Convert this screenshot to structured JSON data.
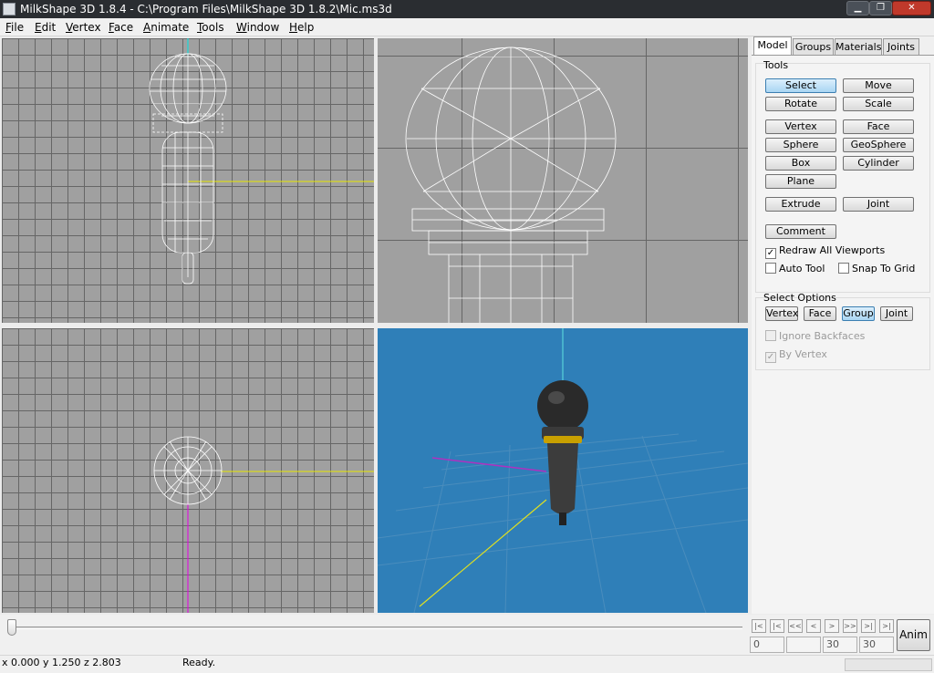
{
  "window": {
    "title": "MilkShape 3D 1.8.4 - C:\\Program Files\\MilkShape 3D 1.8.2\\Mic.ms3d"
  },
  "menu": {
    "file": "File",
    "edit": "Edit",
    "vertex": "Vertex",
    "face": "Face",
    "animate": "Animate",
    "tools": "Tools",
    "window": "Window",
    "help": "Help"
  },
  "tabs": {
    "model": "Model",
    "groups": "Groups",
    "materials": "Materials",
    "joints": "Joints"
  },
  "tools": {
    "heading": "Tools",
    "select": "Select",
    "move": "Move",
    "rotate": "Rotate",
    "scale": "Scale",
    "vertex": "Vertex",
    "face": "Face",
    "sphere": "Sphere",
    "geosphere": "GeoSphere",
    "box": "Box",
    "cylinder": "Cylinder",
    "plane": "Plane",
    "extrude": "Extrude",
    "joint": "Joint",
    "comment": "Comment",
    "redraw_all": "Redraw All Viewports",
    "auto_tool": "Auto Tool",
    "snap_to_grid": "Snap To Grid",
    "redraw_checked": "✓"
  },
  "select_options": {
    "heading": "Select Options",
    "vertex": "Vertex",
    "face": "Face",
    "group": "Group",
    "joint": "Joint",
    "ignore_backfaces": "Ignore Backfaces",
    "by_vertex": "By Vertex",
    "by_vertex_checked": "✓"
  },
  "timeline": {
    "nav": [
      "|<",
      "|<",
      "<<",
      "<",
      ">",
      ">>",
      ">|",
      ">|"
    ],
    "frame": "0",
    "blank": "",
    "frame_b": "30",
    "frame_c": "30",
    "anim": "Anim"
  },
  "status": {
    "coords": "x 0.000 y 1.250 z 2.803",
    "message": "Ready."
  }
}
